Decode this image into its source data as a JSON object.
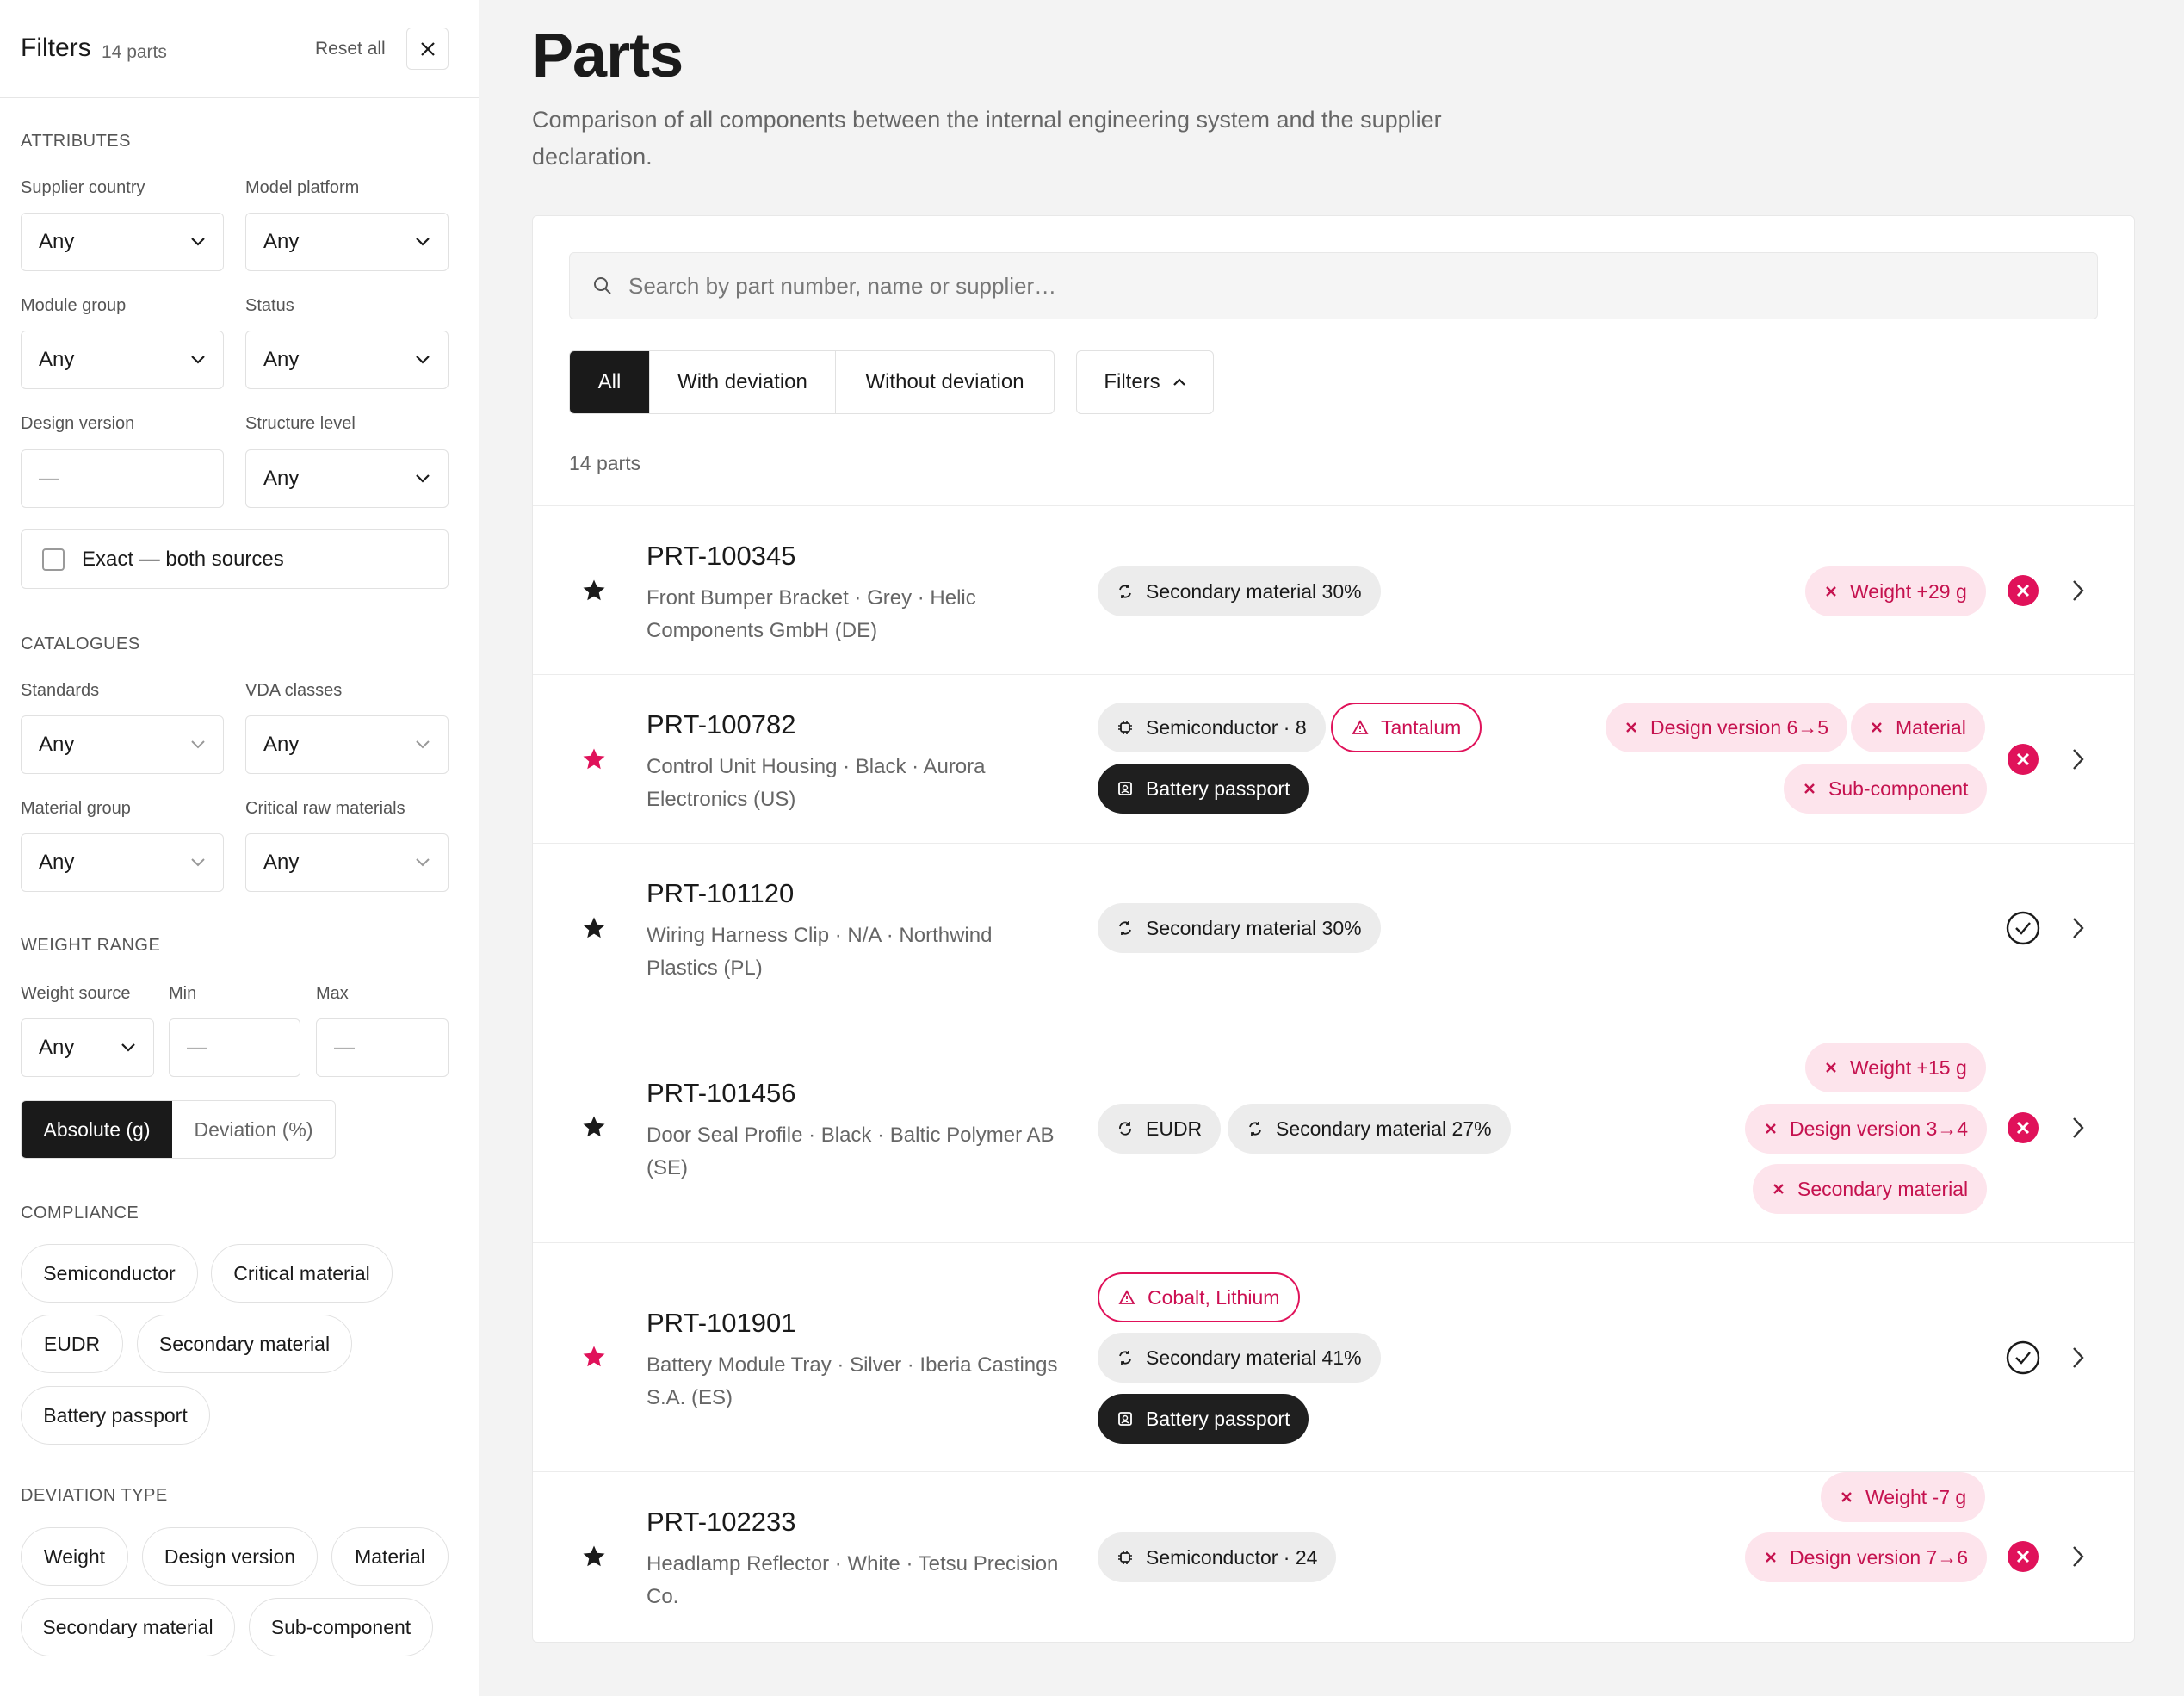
{
  "sidebar": {
    "title": "Filters",
    "count": "14 parts",
    "reset": "Reset all",
    "attributes": {
      "title": "ATTRIBUTES",
      "supplier_country": {
        "label": "Supplier country",
        "value": "Any"
      },
      "model_platform": {
        "label": "Model platform",
        "value": "Any"
      },
      "module_group": {
        "label": "Module group",
        "value": "Any"
      },
      "status": {
        "label": "Status",
        "value": "Any"
      },
      "design_version": {
        "label": "Design version",
        "value": "—"
      },
      "structure_level": {
        "label": "Structure level",
        "value": "Any"
      },
      "exact_label": "Exact — both sources"
    },
    "catalogues": {
      "title": "CATALOGUES",
      "standards": {
        "label": "Standards",
        "value": "Any"
      },
      "vda_classes": {
        "label": "VDA classes",
        "value": "Any"
      },
      "material_group": {
        "label": "Material group",
        "value": "Any"
      },
      "critical_raw_materials": {
        "label": "Critical raw materials",
        "value": "Any"
      }
    },
    "weight": {
      "title": "WEIGHT RANGE",
      "source": {
        "label": "Weight source",
        "value": "Any"
      },
      "min": {
        "label": "Min",
        "value": "—"
      },
      "max": {
        "label": "Max",
        "value": "—"
      },
      "mode_absolute": "Absolute (g)",
      "mode_deviation": "Deviation (%)"
    },
    "compliance": {
      "title": "COMPLIANCE",
      "chips": [
        "Semiconductor",
        "Critical material",
        "EUDR",
        "Secondary material",
        "Battery passport"
      ]
    },
    "deviation_type": {
      "title": "DEVIATION TYPE",
      "chips": [
        "Weight",
        "Design version",
        "Material",
        "Secondary material",
        "Sub-component"
      ]
    }
  },
  "main": {
    "title": "Parts",
    "description": "Comparison of all components between the internal engineering system and the supplier declaration.",
    "search_placeholder": "Search by part number, name or supplier…",
    "tabs": [
      "All",
      "With deviation",
      "Without deviation"
    ],
    "filters_button": "Filters",
    "count": "14 parts"
  },
  "parts": [
    {
      "number": "PRT-100345",
      "desc": "Front Bumper Bracket · Grey · Helic Components GmbH (DE)",
      "starred": false,
      "tags": [
        "Secondary material 30%"
      ],
      "deviations": [
        "Weight +29 g"
      ],
      "status": "deviation"
    },
    {
      "number": "PRT-100782",
      "desc": "Control Unit Housing · Black · Aurora Electronics (US)",
      "starred": true,
      "tags": [
        "Semiconductor · 8",
        "Tantalum",
        "Battery passport"
      ],
      "deviations": [
        "Design version 6→5",
        "Material",
        "Sub-component"
      ],
      "status": "deviation"
    },
    {
      "number": "PRT-101120",
      "desc": "Wiring Harness Clip · N/A · Northwind Plastics (PL)",
      "starred": false,
      "tags": [
        "Secondary material 30%"
      ],
      "deviations": [],
      "status": "ok"
    },
    {
      "number": "PRT-101456",
      "desc": "Door Seal Profile · Black · Baltic Polymer AB (SE)",
      "starred": false,
      "tags": [
        "EUDR",
        "Secondary material 27%"
      ],
      "deviations": [
        "Weight +15 g",
        "Design version 3→4",
        "Secondary material"
      ],
      "status": "deviation"
    },
    {
      "number": "PRT-101901",
      "desc": "Battery Module Tray · Silver · Iberia Castings S.A. (ES)",
      "starred": true,
      "tags": [
        "Cobalt, Lithium",
        "Secondary material 41%",
        "Battery passport"
      ],
      "deviations": [],
      "status": "ok"
    },
    {
      "number": "PRT-102233",
      "desc": "Headlamp Reflector · White · Tetsu Precision Co.",
      "starred": false,
      "tags": [
        "Semiconductor · 24"
      ],
      "deviations": [
        "Weight -7 g",
        "Design version 7→6"
      ],
      "status": "deviation"
    }
  ],
  "colors": {
    "accent": "#e0125a",
    "dark": "#1a1a1a",
    "pink_bg": "#fde4ec",
    "grey_pill": "#ececec"
  }
}
